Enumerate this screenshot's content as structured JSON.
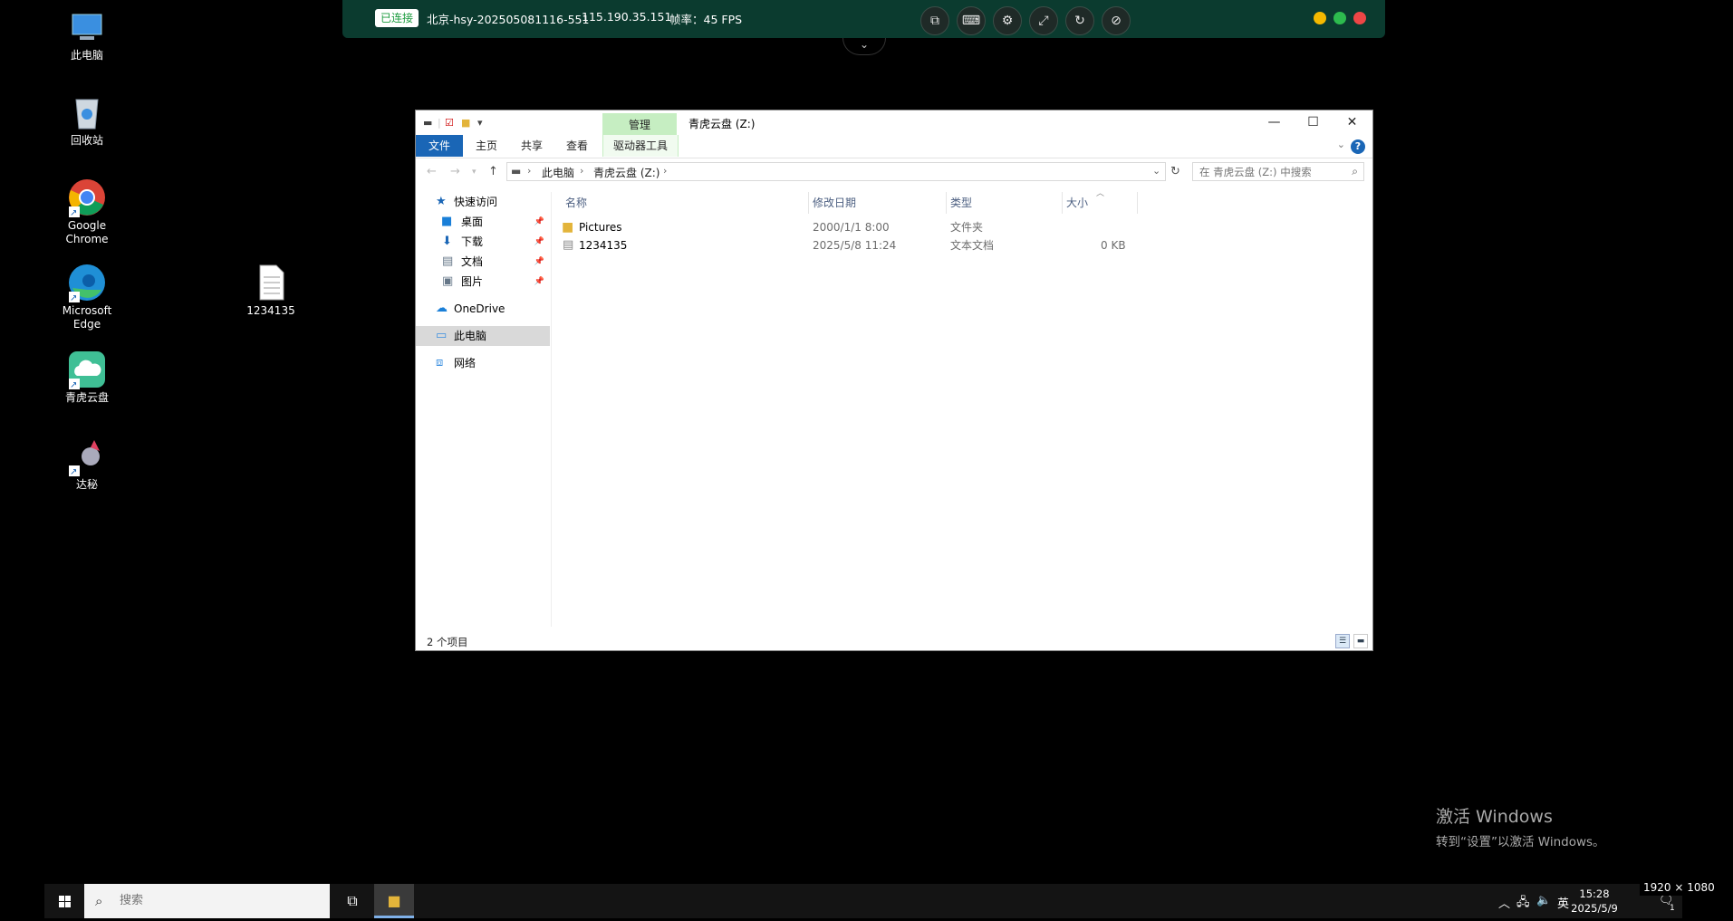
{
  "remote_toolbar": {
    "status": "已连接",
    "host": "北京-hsy-202505081116-551",
    "ip": "115.190.35.151",
    "fps": "帧率：45 FPS",
    "dot_colors": [
      "#f5b900",
      "#2dbb4e",
      "#ee4646"
    ]
  },
  "desktop": {
    "icons": [
      {
        "label": "此电脑"
      },
      {
        "label": "回收站"
      },
      {
        "label": "Google Chrome"
      },
      {
        "label": "Microsoft Edge"
      },
      {
        "label": "青虎云盘"
      },
      {
        "label": "达秘"
      },
      {
        "label": "1234135"
      }
    ],
    "activation_line1": "激活 Windows",
    "activation_line2": "转到“设置”以激活 Windows。"
  },
  "explorer": {
    "title": "青虎云盘 (Z:)",
    "manage_tab": "管理",
    "ribbon_tabs": {
      "file": "文件",
      "home": "主页",
      "share": "共享",
      "view": "查看",
      "drive_tools": "驱动器工具"
    },
    "breadcrumb": {
      "root": "此电脑",
      "current": "青虎云盘 (Z:)"
    },
    "search_placeholder": "在 青虎云盘 (Z:) 中搜索",
    "nav": {
      "quick_access": "快速访问",
      "desktop": "桌面",
      "downloads": "下载",
      "documents": "文档",
      "pictures": "图片",
      "onedrive": "OneDrive",
      "this_pc": "此电脑",
      "network": "网络"
    },
    "columns": {
      "name": "名称",
      "modified": "修改日期",
      "type": "类型",
      "size": "大小"
    },
    "files": [
      {
        "name": "Pictures",
        "modified": "2000/1/1 8:00",
        "type": "文件夹",
        "size": ""
      },
      {
        "name": "1234135",
        "modified": "2025/5/8 11:24",
        "type": "文本文档",
        "size": "0 KB"
      }
    ],
    "status": "2 个项目"
  },
  "taskbar": {
    "search_placeholder": "搜索",
    "ime": "英",
    "time": "15:28",
    "date": "2025/5/9",
    "notification_count": "1"
  },
  "resolution_badge": "1920 × 1080"
}
